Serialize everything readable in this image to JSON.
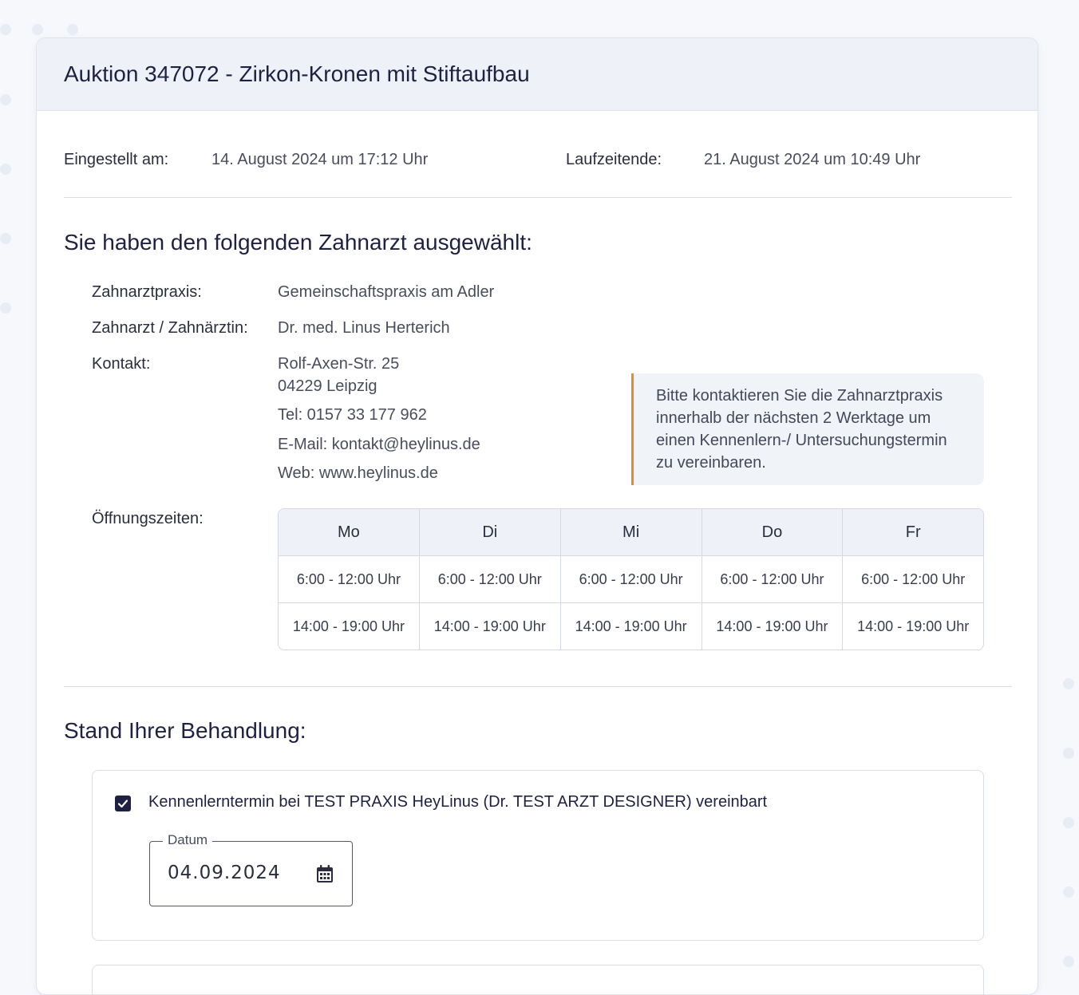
{
  "auction": {
    "title": "Auktion 347072 - Zirkon-Kronen mit Stiftaufbau",
    "posted_label": "Eingestellt am:",
    "posted_value": "14. August 2024 um 17:12 Uhr",
    "end_label": "Laufzeitende:",
    "end_value": "21. August 2024 um 10:49 Uhr"
  },
  "dentist": {
    "heading": "Sie haben den folgenden Zahnarzt ausgewählt:",
    "practice_label": "Zahnarztpraxis:",
    "practice_value": "Gemeinschaftspraxis am Adler",
    "doctor_label": "Zahnarzt / Zahnärztin:",
    "doctor_value": "Dr. med. Linus Herterich",
    "contact_label": "Kontakt:",
    "street": "Rolf-Axen-Str. 25",
    "city": "04229 Leipzig",
    "phone": "Tel: 0157 33 177 962",
    "email": "E-Mail: kontakt@heylinus.de",
    "web": "Web: www.heylinus.de",
    "notice": "Bitte kontaktieren Sie die Zahnarztpraxis innerhalb der nächsten 2 Werktage um einen Kennenlern-/ Untersuchungstermin zu vereinbaren.",
    "hours_label": "Öffnungszeiten:",
    "hours": {
      "days": [
        "Mo",
        "Di",
        "Mi",
        "Do",
        "Fr"
      ],
      "morning": [
        "6:00 - 12:00 Uhr",
        "6:00 - 12:00 Uhr",
        "6:00 - 12:00 Uhr",
        "6:00 - 12:00 Uhr",
        "6:00 - 12:00 Uhr"
      ],
      "afternoon": [
        "14:00 - 19:00 Uhr",
        "14:00 - 19:00 Uhr",
        "14:00 - 19:00 Uhr",
        "14:00 - 19:00 Uhr",
        "14:00 - 19:00 Uhr"
      ]
    }
  },
  "treatment": {
    "heading": "Stand Ihrer Behandlung:",
    "step1": {
      "checked": true,
      "text": "Kennenlerntermin bei TEST PRAXIS HeyLinus (Dr. TEST ARZT DESIGNER) vereinbart",
      "date_label": "Datum",
      "date_value": "04.09.2024",
      "icon": "calendar-icon"
    }
  },
  "colors": {
    "accent": "#e98a2c",
    "primary_dark": "#1f2142",
    "header_bg": "#eef2f8"
  }
}
